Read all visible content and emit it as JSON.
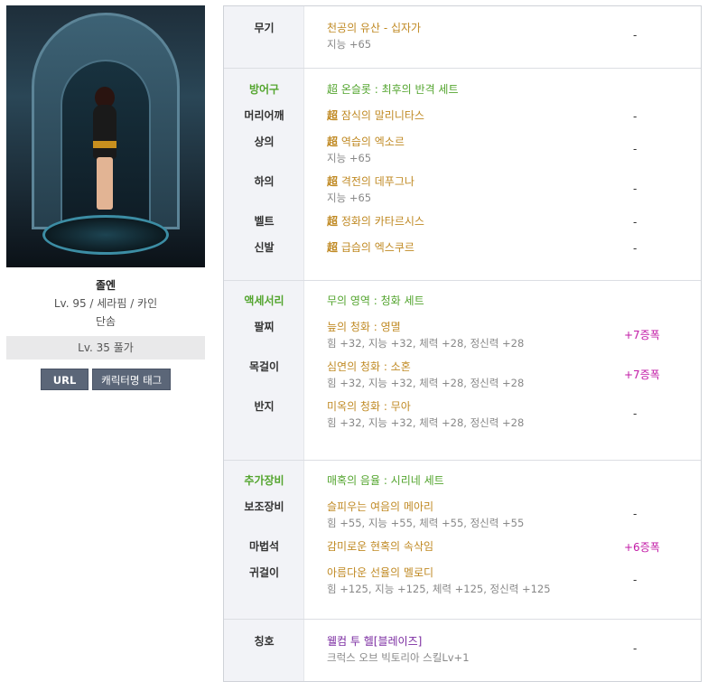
{
  "character": {
    "name": "졸엔",
    "meta": "Lv. 95 / 세라핌 / 카인",
    "guild": "단솜",
    "fame": "Lv. 35 풀가",
    "buttons": {
      "url": "URL",
      "tag": "캐릭터명 태그"
    }
  },
  "equipment": {
    "weapon": {
      "slot": "무기",
      "name": "천공의 유산 - 십자가",
      "stat": "지능 +65",
      "grade": "-"
    },
    "armor": {
      "category": "방어구",
      "set_name": "超 온슬롯 : 최후의 반격 세트",
      "items": [
        {
          "slot": "머리어깨",
          "prefix": "超",
          "name": " 잠식의 말리니타스",
          "stat": "",
          "grade": "-"
        },
        {
          "slot": "상의",
          "prefix": "超",
          "name": " 역습의 엑소르",
          "stat": "지능 +65",
          "grade": "-"
        },
        {
          "slot": "하의",
          "prefix": "超",
          "name": " 격전의 데푸그나",
          "stat": "지능 +65",
          "grade": "-"
        },
        {
          "slot": "벨트",
          "prefix": "超",
          "name": " 정화의 카타르시스",
          "stat": "",
          "grade": "-"
        },
        {
          "slot": "신발",
          "prefix": "超",
          "name": " 급습의 엑스쿠르",
          "stat": "",
          "grade": "-"
        }
      ]
    },
    "accessory": {
      "category": "액세서리",
      "set_name": "무의 영역 : 청화 세트",
      "items": [
        {
          "slot": "팔찌",
          "name": "늪의 청화 : 영멸",
          "stat": "힘 +32, 지능 +32, 체력 +28, 정신력 +28",
          "grade": "+7증폭"
        },
        {
          "slot": "목걸이",
          "name": "심연의 청화 : 소혼",
          "stat": "힘 +32, 지능 +32, 체력 +28, 정신력 +28",
          "grade": "+7증폭"
        },
        {
          "slot": "반지",
          "name": "미옥의 청화 : 무아",
          "stat": "힘 +32, 지능 +32, 체력 +28, 정신력 +28",
          "grade": "-"
        }
      ]
    },
    "extra": {
      "category": "추가장비",
      "set_name": "매혹의 음율 : 시리네 세트",
      "items": [
        {
          "slot": "보조장비",
          "name": "슬피우는 여음의 메아리",
          "stat": "힘 +55, 지능 +55, 체력 +55, 정신력 +55",
          "grade": "-"
        },
        {
          "slot": "마법석",
          "name": "감미로운 현혹의 속삭임",
          "stat": "",
          "grade": "+6증폭"
        },
        {
          "slot": "귀걸이",
          "name": "아름다운 선율의 멜로디",
          "stat": "힘 +125, 지능 +125, 체력 +125, 정신력 +125",
          "grade": "-"
        }
      ]
    },
    "title": {
      "slot": "칭호",
      "name": "웰컴 투 헬[블레이즈]",
      "stat": "크럭스 오브 빅토리아 스킬Lv+1",
      "grade": "-"
    }
  }
}
